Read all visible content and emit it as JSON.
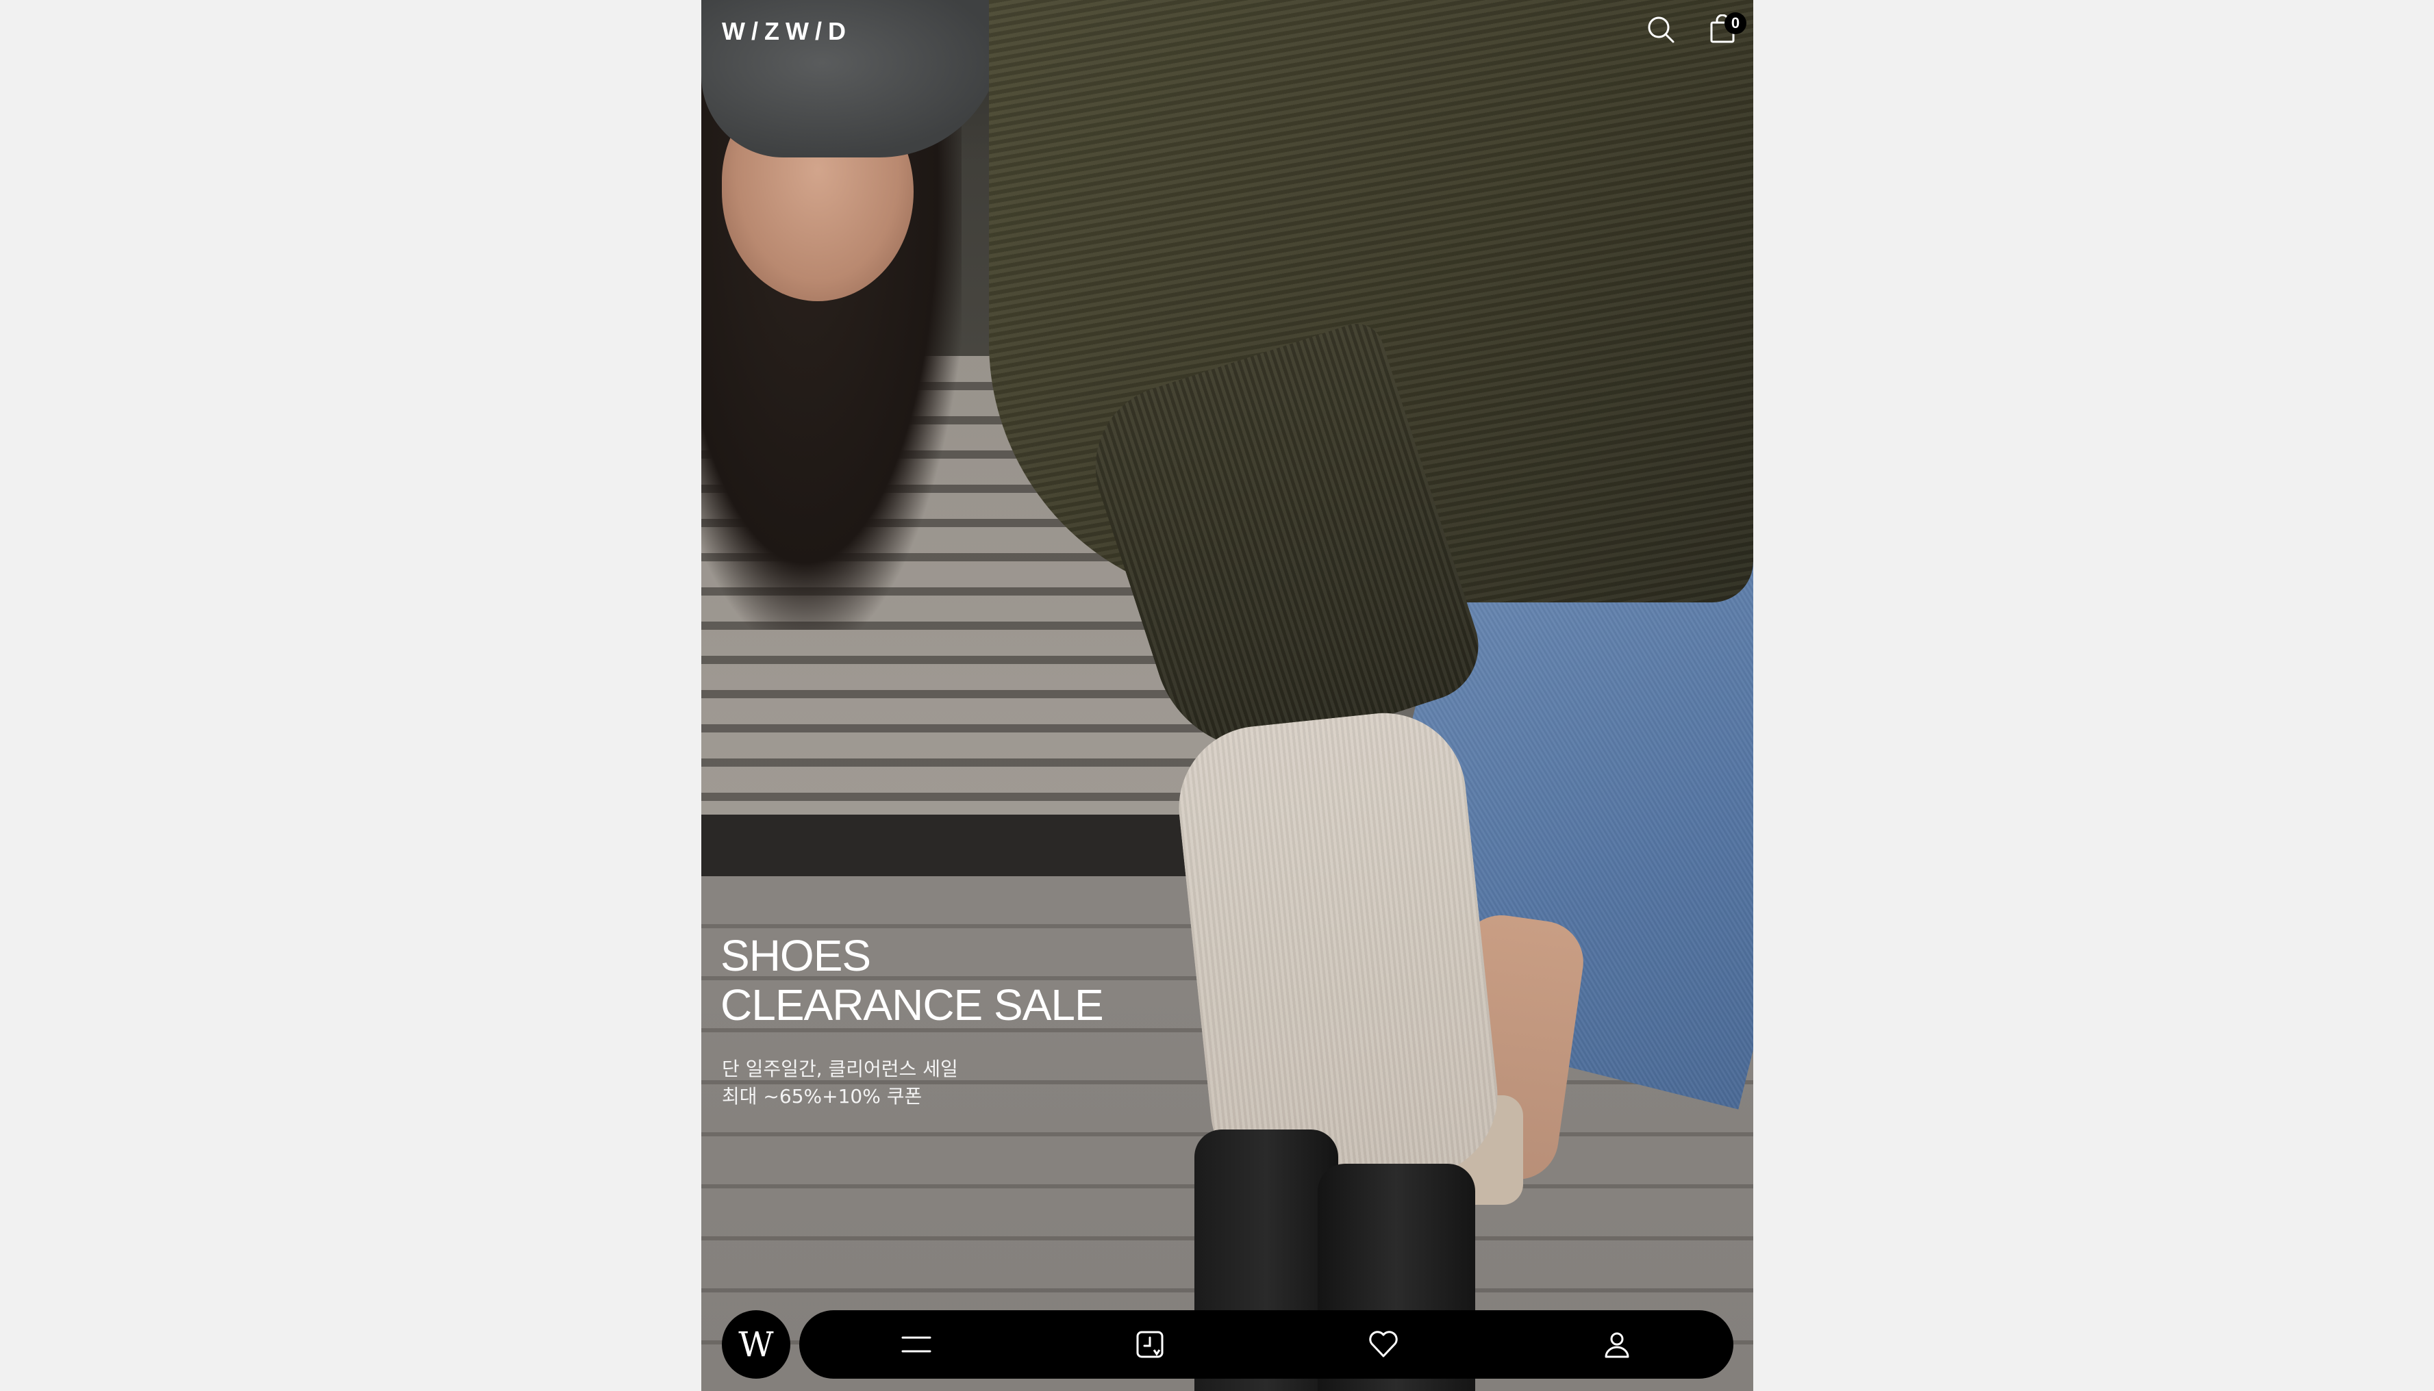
{
  "header": {
    "logo": "W/ZW/D",
    "cart_count": "0",
    "icons": [
      "search-icon",
      "shopping-bag-icon"
    ]
  },
  "hero": {
    "title_line1": "SHOES",
    "title_line2": "CLEARANCE SALE",
    "desc_line1": "단 일주일간, 클리어런스 세일",
    "desc_line2": "최대 ~65%+10% 쿠폰"
  },
  "bottom_nav": {
    "home_label": "W",
    "icons": [
      "menu-icon",
      "recent-viewed-icon",
      "heart-icon",
      "user-icon"
    ]
  },
  "colors": {
    "background": "#f1f1f1",
    "nav_bg": "#000000",
    "text_on_image": "#ffffff"
  }
}
